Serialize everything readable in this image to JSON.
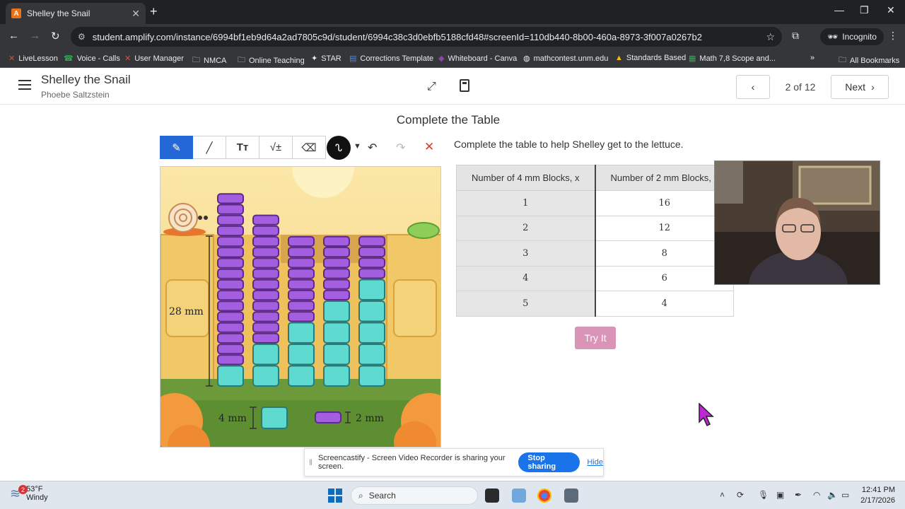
{
  "browser": {
    "tab_title": "Shelley the Snail",
    "url": "student.amplify.com/instance/6994bf1eb9d64a2ad7805c9d/student/6994c38c3d0ebfb5188cfd48#screenId=110db440-8b00-460a-8973-3f007a0267b2",
    "profile_label": "Incognito",
    "bookmarks": [
      "LiveLesson",
      "Voice - Calls",
      "User Manager",
      "NMCA",
      "Online Teaching",
      "STAR",
      "Corrections Template",
      "Whiteboard - Canva",
      "mathcontest.unm.edu",
      "Standards Based",
      "Math 7,8 Scope and..."
    ],
    "all_bookmarks": "All Bookmarks"
  },
  "app": {
    "title": "Shelley the Snail",
    "student": "Phoebe Saltzstein",
    "page_indicator": "2 of 12",
    "next_label": "Next"
  },
  "activity": {
    "heading": "Complete the Table",
    "instruction": "Complete the table to help Shelley get to the lettuce.",
    "scene_labels": {
      "height": "28 mm",
      "block4": "4 mm",
      "block2": "2 mm"
    },
    "table": {
      "headers": [
        "Number of 4 mm Blocks, x",
        "Number of 2 mm Blocks, y"
      ],
      "rows": [
        [
          "1",
          "16"
        ],
        [
          "2",
          "12"
        ],
        [
          "3",
          "8"
        ],
        [
          "4",
          "6"
        ],
        [
          "5",
          "4"
        ]
      ]
    },
    "try_label": "Try It"
  },
  "towers": [
    {
      "teal": 1,
      "purple": 16
    },
    {
      "teal": 2,
      "purple": 12
    },
    {
      "teal": 3,
      "purple": 8
    },
    {
      "teal": 4,
      "purple": 6
    },
    {
      "teal": 5,
      "purple": 4
    }
  ],
  "screencastify": {
    "message": "Screencastify - Screen Video Recorder is sharing your screen.",
    "stop_label": "Stop sharing",
    "hide_label": "Hide"
  },
  "taskbar": {
    "weather_temp": "53°F",
    "weather_desc": "Windy",
    "weather_badge": "2",
    "search_label": "Search",
    "time": "12:41 PM",
    "date": "2/17/2026"
  },
  "colors": {
    "accent": "#2468d8",
    "try_button": "#d994b8",
    "purple_block": "#a45ee0",
    "teal_block": "#5edad0"
  }
}
